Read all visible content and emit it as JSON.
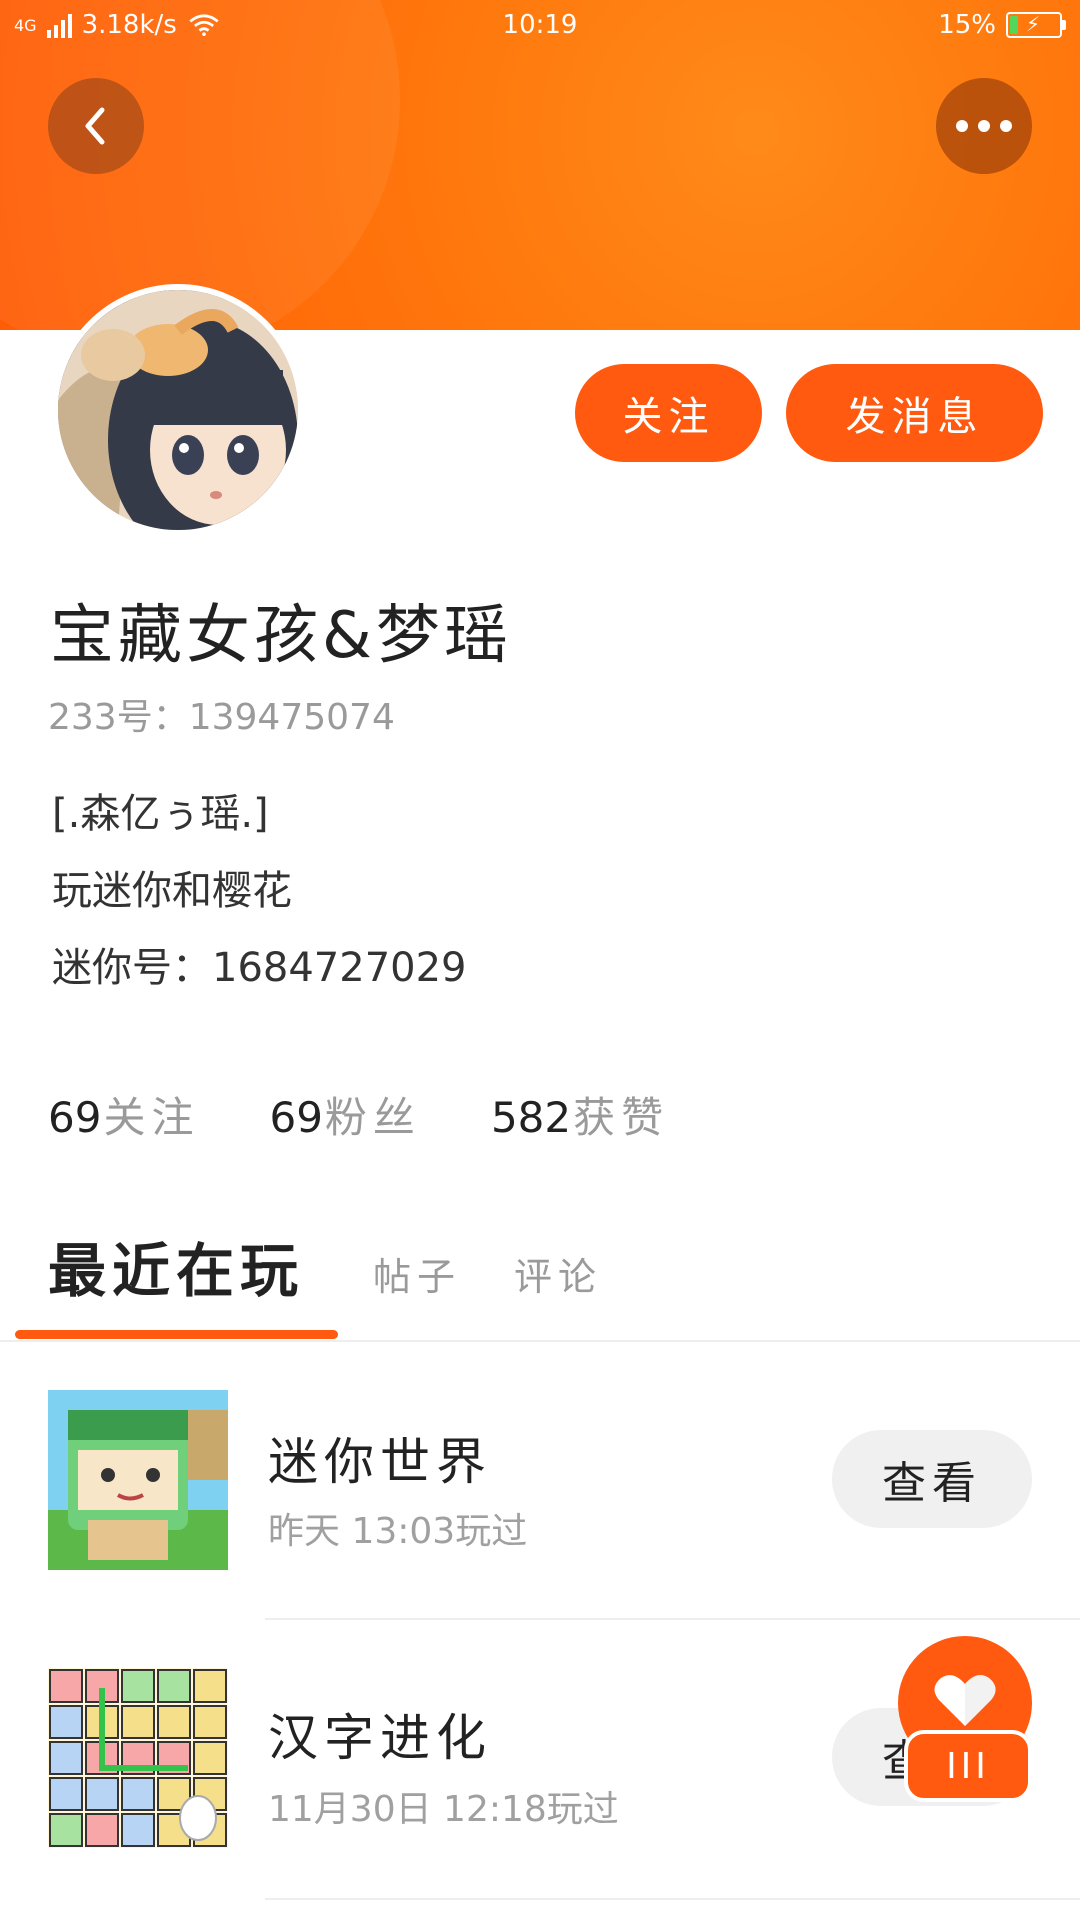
{
  "status_bar": {
    "network": "4G",
    "speed": "3.18k/s",
    "time": "10:19",
    "battery": "15%"
  },
  "header": {
    "back_icon": "back-arrow-icon",
    "more_icon": "more-dots-icon",
    "accent_color": "#ff6a08"
  },
  "profile": {
    "follow_label": "关注",
    "message_label": "发消息",
    "nickname": "宝藏女孩&梦瑶",
    "uid": "233号：139475074",
    "bio_lines": [
      "[.森亿ぅ瑶.]",
      "玩迷你和樱花",
      "迷你号：1684727029"
    ]
  },
  "stats": [
    {
      "num": "69",
      "label": "关注"
    },
    {
      "num": "69",
      "label": "粉丝"
    },
    {
      "num": "582",
      "label": "获赞"
    }
  ],
  "tabs": {
    "active": "最近在玩",
    "posts": "帖子",
    "comments": "评论"
  },
  "games": [
    {
      "name": "迷你世界",
      "time": "昨天 13:03玩过",
      "button": "查看"
    },
    {
      "name": "汉字进化",
      "time": "11月30日 12:18玩过",
      "button": "查看"
    }
  ],
  "floating": {
    "like_icon": "heart-icon",
    "menu_label": "III"
  }
}
